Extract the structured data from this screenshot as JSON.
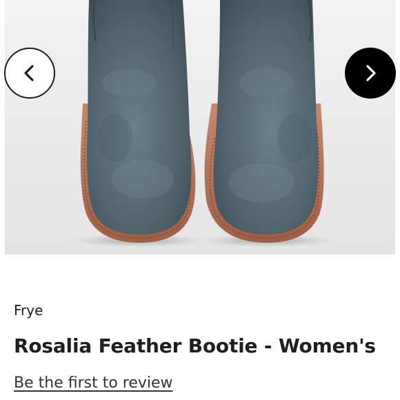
{
  "product": {
    "brand": "Frye",
    "title": "Rosalia Feather Bootie - Women's",
    "review_link": "Be the first to review"
  },
  "gallery": {
    "prev_icon": "chevron-left-icon",
    "next_icon": "chevron-right-icon",
    "image_subject": "product-image",
    "colors": {
      "suede": "#51636d",
      "sole": "#b7765b",
      "next_button_bg": "#000000",
      "prev_button_bg": "#ffffff"
    }
  }
}
